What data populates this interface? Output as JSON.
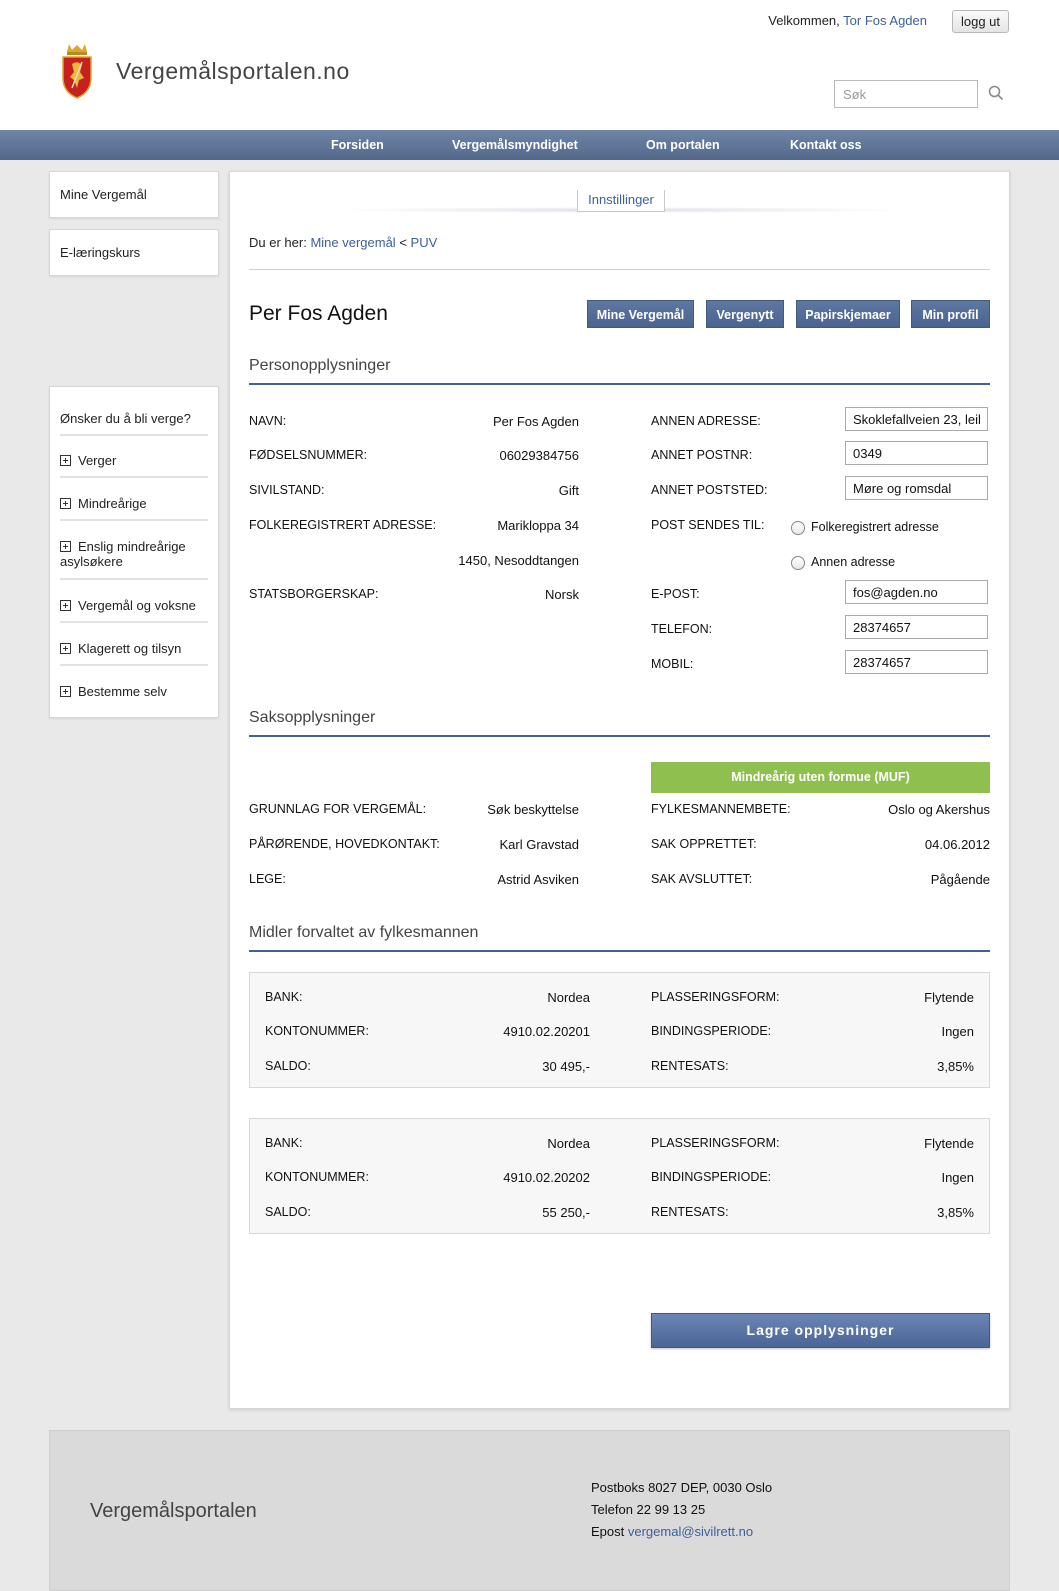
{
  "header": {
    "welcome_prefix": "Velkommen,",
    "user_name": "Tor Fos Agden",
    "logout_label": "logg ut",
    "site_title": "Vergemålsportalen.no",
    "search_placeholder": "Søk"
  },
  "nav": {
    "items": [
      "Forsiden",
      "Vergemålsmyndighet",
      "Om portalen",
      "Kontakt oss"
    ]
  },
  "sidebar": {
    "links": [
      "Mine Vergemål",
      "E-læringskurs"
    ],
    "info_title": "Ønsker du å bli verge?",
    "info_items": [
      "Verger",
      "Mindreårige",
      "Enslig mindreårige asylsøkere",
      "Vergemål og voksne",
      "Klagerett og tilsyn",
      "Bestemme selv"
    ]
  },
  "main": {
    "settings_tab": "Innstillinger",
    "breadcrumb": {
      "prefix": "Du er her:",
      "items": [
        "Mine vergemål",
        "PUV"
      ],
      "separator": "<"
    },
    "person_name": "Per Fos Agden",
    "tabs": [
      "Mine Vergemål",
      "Vergenytt",
      "Papirskjemaer",
      "Min profil"
    ],
    "personal": {
      "title": "Personopplysninger",
      "left": [
        {
          "label": "NAVN:",
          "value": "Per Fos Agden"
        },
        {
          "label": "FØDSELSNUMMER:",
          "value": "06029384756"
        },
        {
          "label": "SIVILSTAND:",
          "value": "Gift"
        },
        {
          "label": "FOLKEREGISTRERT ADRESSE:",
          "value": "Marikloppa 34",
          "value2": "1450, Nesoddtangen"
        },
        {
          "label": "STATSBORGERSKAP:",
          "value": "Norsk"
        }
      ],
      "right": {
        "other_address": {
          "label": "ANNEN ADRESSE:",
          "value": "Skoklefallveien 23, leil"
        },
        "other_zip": {
          "label": "ANNET POSTNR:",
          "value": "0349"
        },
        "other_city": {
          "label": "ANNET POSTSTED:",
          "value": "Møre og romsdal"
        },
        "post_to": {
          "label": "POST SENDES TIL:",
          "options": [
            "Folkeregistrert adresse",
            "Annen adresse"
          ]
        },
        "email": {
          "label": "E-POST:",
          "value": "fos@agden.no"
        },
        "phone": {
          "label": "TELEFON:",
          "value": "28374657"
        },
        "mobile": {
          "label": "MOBIL:",
          "value": "28374657"
        }
      }
    },
    "case": {
      "title": "Saksopplysninger",
      "badge": "Mindreårig uten formue (MUF)",
      "left": [
        {
          "label": "GRUNNLAG FOR VERGEMÅL:",
          "value": "Søk beskyttelse"
        },
        {
          "label": "PÅRØRENDE, HOVEDKONTAKT:",
          "value": "Karl Gravstad"
        },
        {
          "label": "LEGE:",
          "value": "Astrid Asviken"
        }
      ],
      "right": [
        {
          "label": "FYLKESMANNEMBETE:",
          "value": "Oslo og Akershus"
        },
        {
          "label": "SAK OPPRETTET:",
          "value": "04.06.2012"
        },
        {
          "label": "SAK AVSLUTTET:",
          "value": "Pågående"
        }
      ]
    },
    "funds": {
      "title": "Midler forvaltet av fylkesmannen",
      "accounts": [
        {
          "left": [
            {
              "label": "BANK:",
              "value": "Nordea"
            },
            {
              "label": "KONTONUMMER:",
              "value": "4910.02.20201"
            },
            {
              "label": "SALDO:",
              "value": "30 495,-"
            }
          ],
          "right": [
            {
              "label": "PLASSERINGSFORM:",
              "value": "Flytende"
            },
            {
              "label": "BINDINGSPERIODE:",
              "value": "Ingen"
            },
            {
              "label": "RENTESATS:",
              "value": "3,85%"
            }
          ]
        },
        {
          "left": [
            {
              "label": "BANK:",
              "value": "Nordea"
            },
            {
              "label": "KONTONUMMER:",
              "value": "4910.02.20202"
            },
            {
              "label": "SALDO:",
              "value": "55 250,-"
            }
          ],
          "right": [
            {
              "label": "PLASSERINGSFORM:",
              "value": "Flytende"
            },
            {
              "label": "BINDINGSPERIODE:",
              "value": "Ingen"
            },
            {
              "label": "RENTESATS:",
              "value": "3,85%"
            }
          ]
        }
      ]
    },
    "save_label": "Lagre opplysninger"
  },
  "footer": {
    "brand": "Vergemålsportalen",
    "address": "Postboks 8027 DEP, 0030 Oslo",
    "phone": "Telefon 22 99 13 25",
    "email_prefix": "Epost",
    "email": "vergemal@sivilrett.no"
  },
  "colors": {
    "accent": "#4a6390",
    "link": "#3b5f9a",
    "badge_green": "#8fc04f",
    "crest_red": "#c8201e",
    "crest_gold": "#d9a82a"
  }
}
